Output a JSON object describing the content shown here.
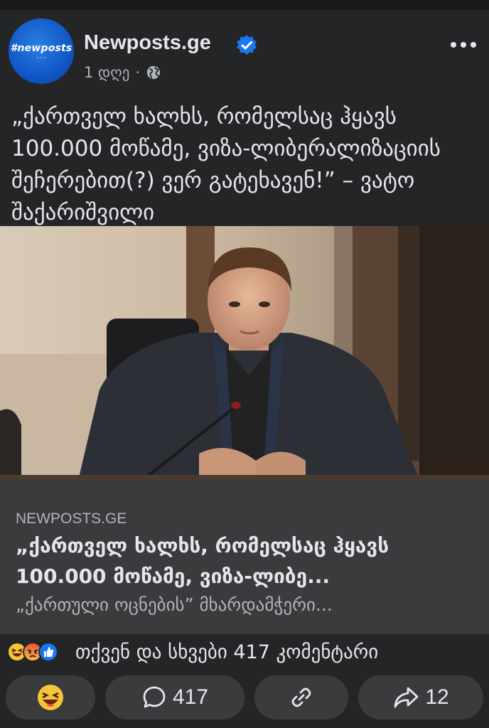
{
  "post": {
    "page_name": "Newposts.ge",
    "avatar_text": "#newposts",
    "time": "1 დღე",
    "separator": "·",
    "caption": "„ქართველ ხალხს, რომელსაც ჰყავს 100.000 მოწამე, ვიზა-ლიბერალიზაციის შეჩერებით(?) ვერ გატეხავენ!” – ვატო შაქარიშვილი"
  },
  "link_preview": {
    "domain": "NEWPOSTS.GE",
    "title": "„ქართველ ხალხს, რომელსაც ჰყავს 100.000 მოწამე, ვიზა-ლიბე...",
    "description": "„ქართული ოცნების” მხარდამჭერი..."
  },
  "reactions": {
    "summary": "თქვენ და სხვები 417 კომენტარი",
    "icons": [
      "haha-icon",
      "angry-icon",
      "like-icon"
    ]
  },
  "actions": {
    "comment_count": "417",
    "share_count": "12"
  },
  "colors": {
    "background": "#242526",
    "card": "#3a3b3c",
    "text": "#e4e6eb",
    "secondary_text": "#b0b3b8",
    "verified": "#1877f2"
  }
}
